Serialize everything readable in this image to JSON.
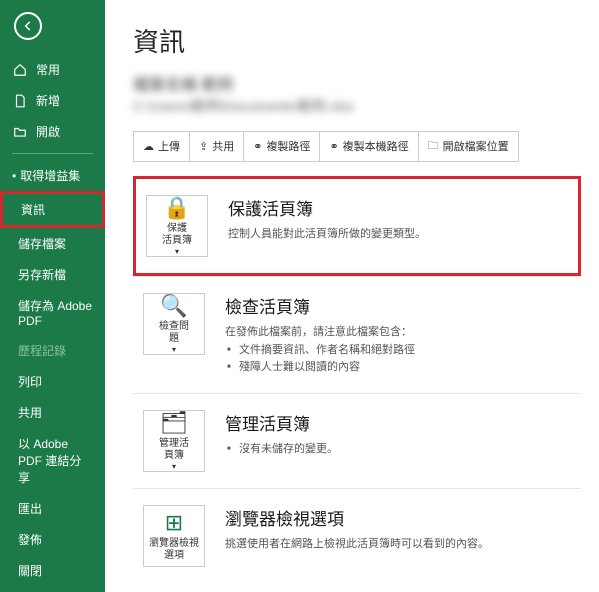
{
  "sidebar": {
    "items": [
      {
        "label": "常用"
      },
      {
        "label": "新增"
      },
      {
        "label": "開啟"
      },
      {
        "label": "取得增益集"
      },
      {
        "label": "資訊"
      },
      {
        "label": "儲存檔案"
      },
      {
        "label": "另存新檔"
      },
      {
        "label": "儲存為 Adobe PDF"
      },
      {
        "label": "歷程記錄"
      },
      {
        "label": "列印"
      },
      {
        "label": "共用"
      },
      {
        "label": "以 Adobe PDF 連結分享"
      },
      {
        "label": "匯出"
      },
      {
        "label": "發佈"
      },
      {
        "label": "關閉"
      }
    ]
  },
  "page": {
    "title": "資訊"
  },
  "doc": {
    "name": "檔案名稱 範例",
    "path": "C:\\Users\\範例\\Documents\\範例.xlsx"
  },
  "toolbar": {
    "upload": "上傳",
    "share": "共用",
    "copypath": "複製路徑",
    "copylocal": "複製本機路徑",
    "openloc": "開啟檔案位置"
  },
  "sections": {
    "protect": {
      "btn": "保護\n活頁簿",
      "title": "保護活頁簿",
      "text": "控制人員能對此活頁簿所做的變更類型。"
    },
    "inspect": {
      "btn": "檢查問\n題",
      "title": "檢查活頁簿",
      "lead": "在發佈此檔案前，請注意此檔案包含：",
      "b1": "文件摘要資訊、作者名稱和絕對路徑",
      "b2": "殘障人士難以閱讀的內容"
    },
    "manage": {
      "btn": "管理活\n頁簿",
      "title": "管理活頁簿",
      "b1": "沒有未儲存的變更。"
    },
    "browser": {
      "btn": "瀏覽器檢視\n選項",
      "title": "瀏覽器檢視選項",
      "text": "挑選使用者在網路上檢視此活頁簿時可以看到的內容。"
    }
  }
}
